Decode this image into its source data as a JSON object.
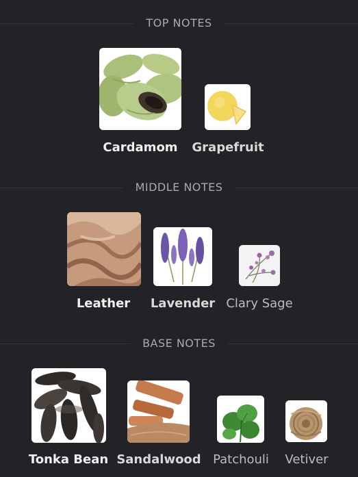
{
  "sections": {
    "top": {
      "title": "TOP NOTES",
      "notes": [
        {
          "label": "Cardamom",
          "icon": "cardamom-image"
        },
        {
          "label": "Grapefruit",
          "icon": "grapefruit-image"
        }
      ]
    },
    "middle": {
      "title": "MIDDLE NOTES",
      "notes": [
        {
          "label": "Leather",
          "icon": "leather-image"
        },
        {
          "label": "Lavender",
          "icon": "lavender-image"
        },
        {
          "label": "Clary Sage",
          "icon": "clary-sage-image"
        }
      ]
    },
    "base": {
      "title": "BASE NOTES",
      "notes": [
        {
          "label": "Tonka Bean",
          "icon": "tonka-bean-image"
        },
        {
          "label": "Sandalwood",
          "icon": "sandalwood-image"
        },
        {
          "label": "Patchouli",
          "icon": "patchouli-image"
        },
        {
          "label": "Vetiver",
          "icon": "vetiver-image"
        }
      ]
    }
  },
  "colors": {
    "background": "#232226",
    "divider": "#34333a",
    "header_text": "#a9a9b1"
  }
}
